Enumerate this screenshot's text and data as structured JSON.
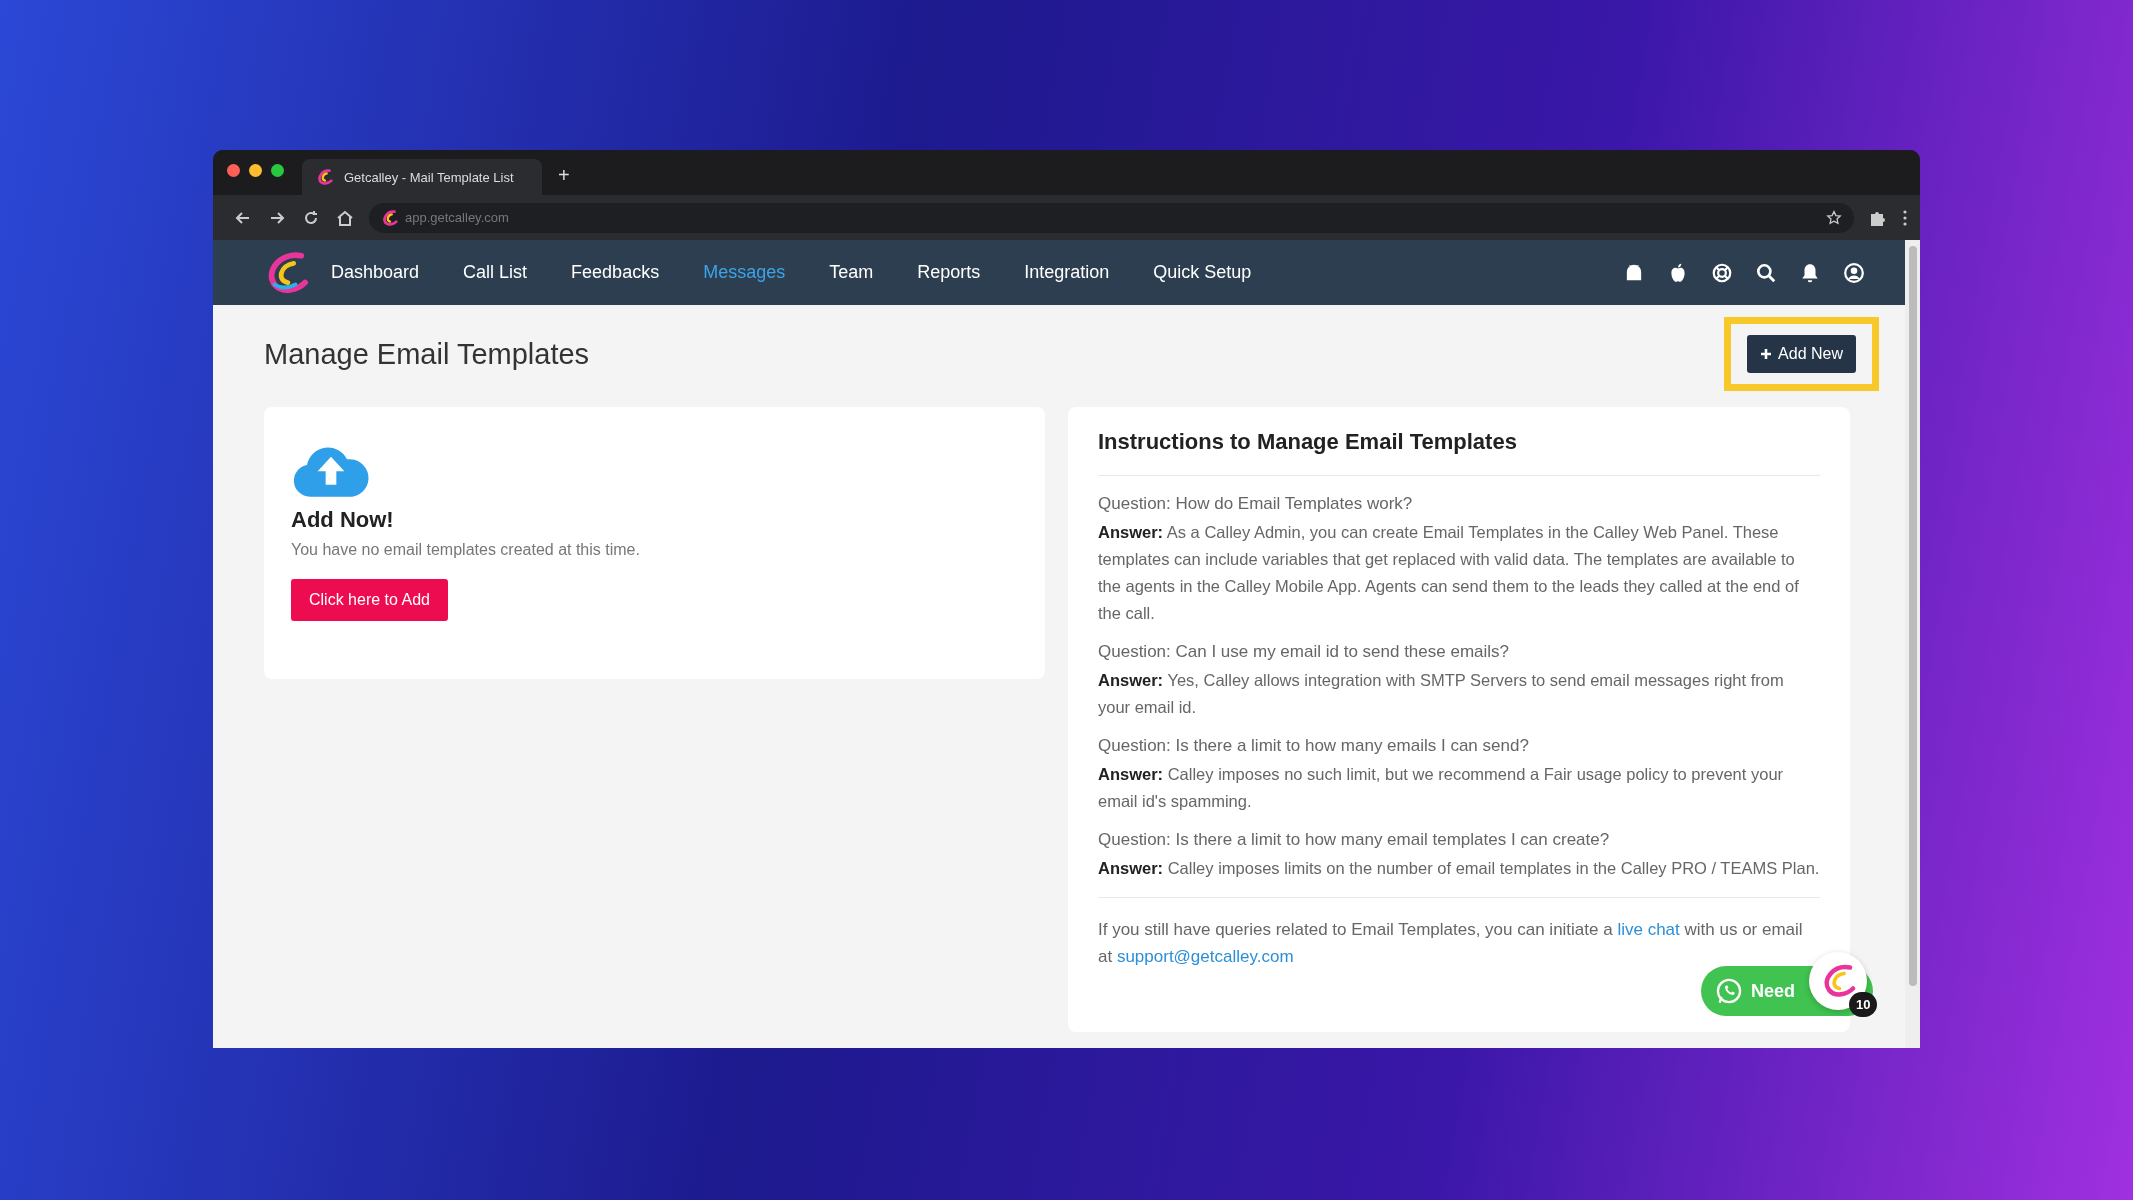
{
  "browser": {
    "tab_title": "Getcalley - Mail Template List",
    "new_tab": "+",
    "address": "app.getcalley.com"
  },
  "nav": {
    "items": [
      {
        "label": "Dashboard",
        "selected": false
      },
      {
        "label": "Call List",
        "selected": false
      },
      {
        "label": "Feedbacks",
        "selected": false
      },
      {
        "label": "Messages",
        "selected": true
      },
      {
        "label": "Team",
        "selected": false
      },
      {
        "label": "Reports",
        "selected": false
      },
      {
        "label": "Integration",
        "selected": false
      },
      {
        "label": "Quick Setup",
        "selected": false
      }
    ]
  },
  "page": {
    "title": "Manage Email Templates",
    "add_button": "Add New"
  },
  "empty_card": {
    "title": "Add Now!",
    "message": "You have no email templates created at this time.",
    "button": "Click here to Add"
  },
  "instructions": {
    "title": "Instructions to Manage Email Templates",
    "faqs": [
      {
        "question": "Question: How do Email Templates work?",
        "answer": "**Answer:** As a Calley Admin, you can create Email Templates in the Calley Web Panel. These templates can include variables that get replaced with valid data. The templates are available to the agents in the Calley Mobile App. Agents can send them to the leads they called at the end of the call."
      },
      {
        "question": "Question: Can I use my email id to send these emails?",
        "answer": "**Answer:** Yes, Calley allows integration with SMTP Servers to send email messages right from your email id."
      },
      {
        "question": "Question: Is there a limit to how many emails I can send?",
        "answer": "**Answer:** Calley imposes no such limit, but we recommend a Fair usage policy to prevent your email id's spamming."
      },
      {
        "question": "Question: Is there a limit to how many email templates I can create?",
        "answer": "**Answer:** Calley imposes limits on the number of email templates in the Calley PRO / TEAMS Plan."
      }
    ],
    "footer": {
      "text_before": "If you still have queries related to Email Templates, you can initiate a ",
      "link": "live chat",
      "text_after": " with us or email",
      "line2": "at ",
      "email": "support@getcalley.com"
    }
  },
  "chat_widget": {
    "label": "Need",
    "badge": "10"
  }
}
